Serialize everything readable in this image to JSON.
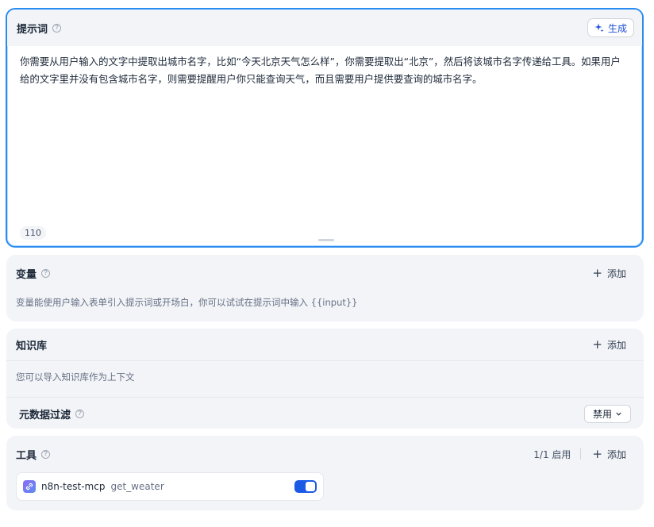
{
  "prompt": {
    "title": "提示词",
    "generate_label": "生成",
    "text": "你需要从用户输入的文字中提取出城市名字，比如“今天北京天气怎么样”，你需要提取出“北京”，然后将该城市名字传递给工具。如果用户给的文字里并没有包含城市名字，则需要提醒用户你只能查询天气，而且需要用户提供要查询的城市名字。",
    "char_count": "110"
  },
  "variables": {
    "title": "变量",
    "add_label": "添加",
    "description": "变量能使用户输入表单引入提示词或开场白，你可以试试在提示词中输入 {{input}}"
  },
  "knowledge": {
    "title": "知识库",
    "add_label": "添加",
    "description": "您可以导入知识库作为上下文",
    "metadata_filter": {
      "title": "元数据过滤",
      "selected": "禁用"
    }
  },
  "tools": {
    "title": "工具",
    "enabled_count": "1/1 启用",
    "add_label": "添加",
    "items": [
      {
        "name": "n8n-test-mcp",
        "function": "get_weater",
        "enabled": true
      }
    ]
  },
  "colors": {
    "accent": "#2a8cf1",
    "toggle_on": "#1c5ae6",
    "panel_bg": "#f2f4f7"
  }
}
